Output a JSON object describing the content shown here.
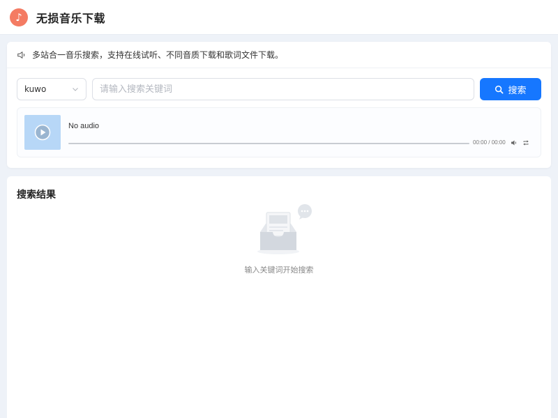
{
  "header": {
    "logo_glyph": "♪",
    "title": "无损音乐下载"
  },
  "notice": {
    "text": "多站合一音乐搜索，支持在线试听、不同音质下载和歌词文件下载。"
  },
  "search": {
    "source_value": "kuwo",
    "input_value": "",
    "placeholder": "请输入搜索关键词",
    "button_label": "搜索"
  },
  "player": {
    "track_label": "No audio",
    "time_readout": "00:00 / 00:00",
    "progress": 0
  },
  "results": {
    "title": "搜索结果",
    "empty_text": "输入关键词开始搜索"
  },
  "colors": {
    "accent": "#1677ff",
    "logo": "#f47b63",
    "cover": "#b7d7f7"
  },
  "icons": [
    "music-note-icon",
    "speaker-icon",
    "chevron-down-icon",
    "search-icon",
    "play-icon",
    "volume-icon",
    "loop-icon",
    "empty-inbox-icon"
  ]
}
